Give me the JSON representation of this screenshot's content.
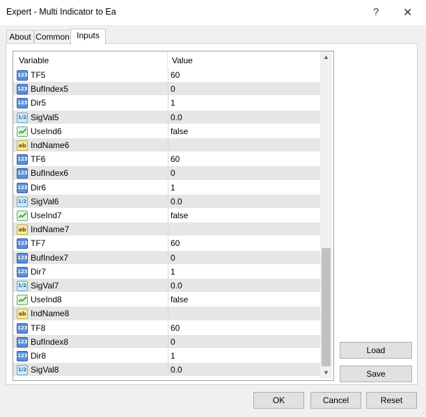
{
  "window": {
    "title": "Expert - Multi Indicator to Ea",
    "help": "?",
    "close": "✕"
  },
  "tabs": [
    "About",
    "Common",
    "Inputs"
  ],
  "grid": {
    "headers": {
      "variable": "Variable",
      "value": "Value"
    },
    "rows": [
      {
        "type": "int",
        "name": "TF5",
        "value": "60"
      },
      {
        "type": "int",
        "name": "BufIndex5",
        "value": "0"
      },
      {
        "type": "int",
        "name": "Dir5",
        "value": "1"
      },
      {
        "type": "dbl",
        "name": "SigVal5",
        "value": "0.0"
      },
      {
        "type": "bool",
        "name": "UseInd6",
        "value": "false"
      },
      {
        "type": "str",
        "name": "IndName6",
        "value": ""
      },
      {
        "type": "int",
        "name": "TF6",
        "value": "60"
      },
      {
        "type": "int",
        "name": "BufIndex6",
        "value": "0"
      },
      {
        "type": "int",
        "name": "Dir6",
        "value": "1"
      },
      {
        "type": "dbl",
        "name": "SigVal6",
        "value": "0.0"
      },
      {
        "type": "bool",
        "name": "UseInd7",
        "value": "false"
      },
      {
        "type": "str",
        "name": "IndName7",
        "value": ""
      },
      {
        "type": "int",
        "name": "TF7",
        "value": "60"
      },
      {
        "type": "int",
        "name": "BufIndex7",
        "value": "0"
      },
      {
        "type": "int",
        "name": "Dir7",
        "value": "1"
      },
      {
        "type": "dbl",
        "name": "SigVal7",
        "value": "0.0"
      },
      {
        "type": "bool",
        "name": "UseInd8",
        "value": "false"
      },
      {
        "type": "str",
        "name": "IndName8",
        "value": ""
      },
      {
        "type": "int",
        "name": "TF8",
        "value": "60"
      },
      {
        "type": "int",
        "name": "BufIndex8",
        "value": "0"
      },
      {
        "type": "int",
        "name": "Dir8",
        "value": "1"
      },
      {
        "type": "dbl",
        "name": "SigVal8",
        "value": "0.0"
      }
    ]
  },
  "icon_labels": {
    "int": "123",
    "dbl": "1/2",
    "str": "ab"
  },
  "buttons": {
    "load": "Load",
    "save": "Save",
    "ok": "OK",
    "cancel": "Cancel",
    "reset": "Reset"
  },
  "scrollbar": {
    "up": "▲",
    "down": "▼"
  },
  "colors": {
    "row_alt": "#e6e6e6",
    "int_icon": "#5b8fd8",
    "bool_icon": "#2e9e2e",
    "str_icon": "#f6e7a8"
  }
}
